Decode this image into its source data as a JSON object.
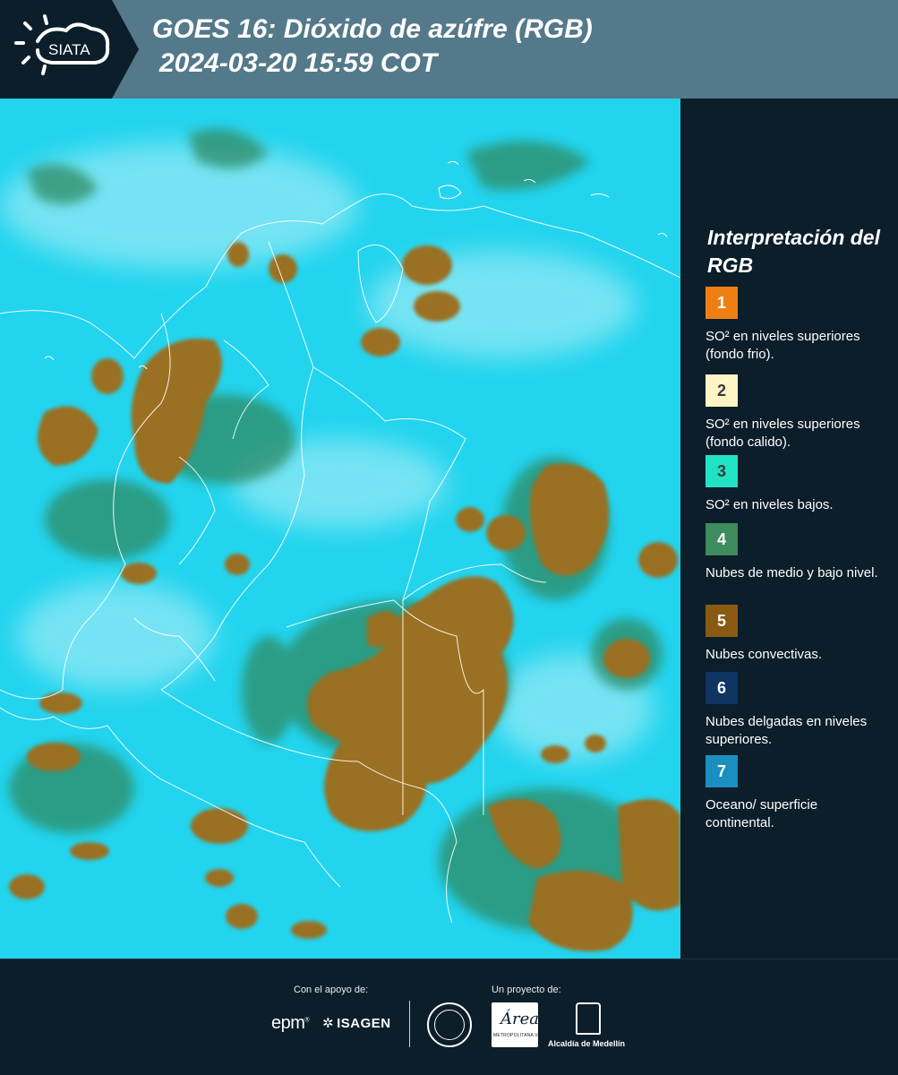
{
  "header": {
    "logo_text": "SIATA",
    "title_line1": "GOES 16: Dióxido de azúfre (RGB)",
    "title_line2": "2024-03-20 15:59 COT"
  },
  "legend": {
    "title": "Interpretación del RGB",
    "items": [
      {
        "num": "1",
        "color": "#f07f13",
        "num_color": "#ffffff",
        "text": "SO² en niveles superiores (fondo frio)."
      },
      {
        "num": "2",
        "color": "#fdf6c4",
        "num_color": "#3a3a3a",
        "text": "SO² en niveles superiores (fondo calido)."
      },
      {
        "num": "3",
        "color": "#20e3c6",
        "num_color": "#3a3a3a",
        "text": "SO² en niveles bajos."
      },
      {
        "num": "4",
        "color": "#3c8c5e",
        "num_color": "#ffffff",
        "text": "Nubes de medio y bajo nivel."
      },
      {
        "num": "5",
        "color": "#8a5a12",
        "num_color": "#ffffff",
        "text": "Nubes convectivas."
      },
      {
        "num": "6",
        "color": "#0f3563",
        "num_color": "#ffffff",
        "text": "Nubes delgadas en niveles superiores."
      },
      {
        "num": "7",
        "color": "#1b8fc1",
        "num_color": "#ffffff",
        "text": "Oceano/ superficie continental."
      }
    ]
  },
  "map": {
    "background_color": "#22d4ee",
    "cloud_color": "#9a7024",
    "shadow_color": "#1f7f62"
  },
  "footer": {
    "support_label": "Con el apoyo de:",
    "project_label": "Un proyecto de:",
    "epm": "epm",
    "isagen": "ISAGEN",
    "area_word": "Área",
    "area_sub": "METROPOLITANA Valle de Aburrá",
    "alcaldia": "Alcaldía de Medellín"
  }
}
